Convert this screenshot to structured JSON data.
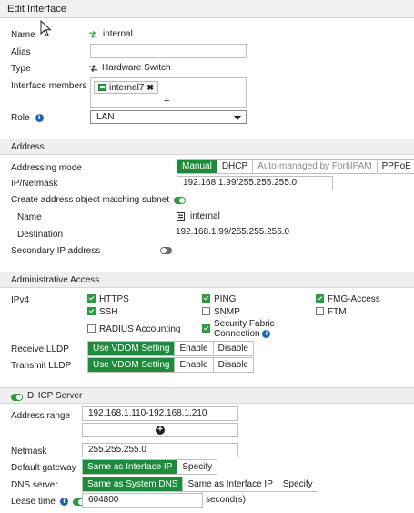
{
  "title": "Edit Interface",
  "general": {
    "name_label": "Name",
    "name_value": "internal",
    "alias_label": "Alias",
    "alias_value": "",
    "type_label": "Type",
    "type_value": "Hardware Switch",
    "members_label": "Interface members",
    "members": [
      "internal7"
    ],
    "add_symbol": "+",
    "role_label": "Role",
    "role_value": "LAN"
  },
  "address": {
    "header": "Address",
    "mode_label": "Addressing mode",
    "mode_options": [
      "Manual",
      "DHCP",
      "Auto-managed by FortiIPAM",
      "PPPoE"
    ],
    "mode_selected": "Manual",
    "ipmask_label": "IP/Netmask",
    "ipmask_value": "192.168.1.99/255.255.255.0",
    "create_obj_label": "Create address object matching subnet",
    "create_obj_enabled": true,
    "obj_name_label": "Name",
    "obj_name_value": "internal",
    "destination_label": "Destination",
    "destination_value": "192.168.1.99/255.255.255.0",
    "secondary_label": "Secondary IP address",
    "secondary_enabled": false
  },
  "admin_access": {
    "header": "Administrative Access",
    "ipv4_label": "IPv4",
    "items": [
      {
        "label": "HTTPS",
        "checked": true
      },
      {
        "label": "PING",
        "checked": true
      },
      {
        "label": "FMG-Access",
        "checked": true
      },
      {
        "label": "SSH",
        "checked": true
      },
      {
        "label": "SNMP",
        "checked": false
      },
      {
        "label": "FTM",
        "checked": false
      },
      {
        "label": "RADIUS Accounting",
        "checked": false
      },
      {
        "label": "Security Fabric Connection",
        "checked": true
      }
    ],
    "receive_lldp_label": "Receive LLDP",
    "transmit_lldp_label": "Transmit LLDP",
    "lldp_options": [
      "Use VDOM Setting",
      "Enable",
      "Disable"
    ],
    "lldp_selected": "Use VDOM Setting"
  },
  "dhcp": {
    "header": "DHCP Server",
    "enabled": true,
    "range_label": "Address range",
    "range_value": "192.168.1.110-192.168.1.210",
    "add_symbol": "+",
    "netmask_label": "Netmask",
    "netmask_value": "255.255.255.0",
    "gateway_label": "Default gateway",
    "gateway_options": [
      "Same as Interface IP",
      "Specify"
    ],
    "gateway_selected": "Same as Interface IP",
    "dns_label": "DNS server",
    "dns_options": [
      "Same as System DNS",
      "Same as Interface IP",
      "Specify"
    ],
    "dns_selected": "Same as System DNS",
    "lease_label": "Lease time",
    "lease_enabled": true,
    "lease_value": "604800",
    "lease_unit": "second(s)"
  },
  "colors": {
    "accent_green": "#1e8a3c",
    "info_blue": "#1c64b3",
    "header_gray": "#efefef"
  }
}
